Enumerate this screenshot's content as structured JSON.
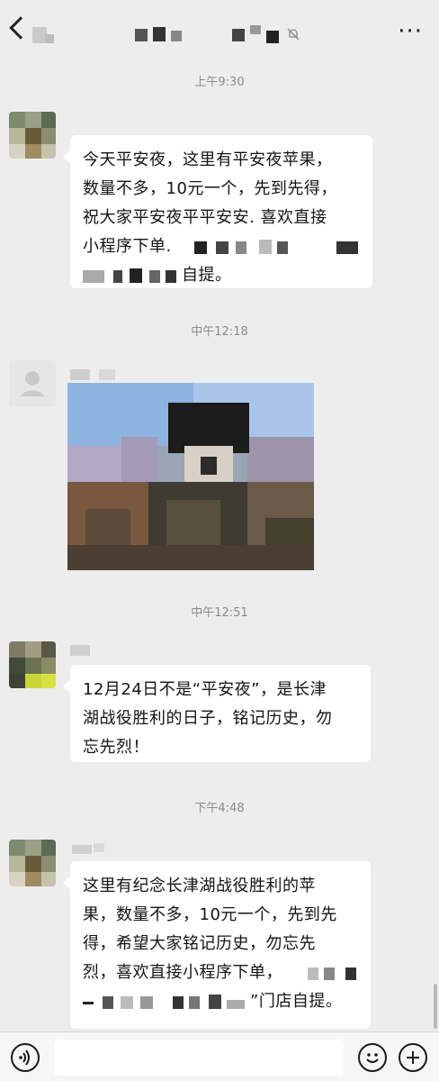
{
  "header": {
    "back_icon": "chevron-left-icon",
    "more_icon": "more-dots-icon",
    "mute_icon": "bell-mute-icon",
    "title_obscured": true
  },
  "messages": [
    {
      "timestamp": "上午9:30",
      "type": "text",
      "lines": [
        "今天平安夜，这里有平安夜苹果，",
        "数量不多，10元一个，先到先得，",
        "祝大家平安夜平平安安. 喜欢直接",
        "小程序下单."
      ],
      "tail": "自提。"
    },
    {
      "timestamp": "中午12:18",
      "type": "image"
    },
    {
      "timestamp": "中午12:51",
      "type": "text",
      "lines": [
        "12月24日不是“平安夜”，是长津",
        "湖战役胜利的日子，铭记历史，勿",
        "忘先烈！"
      ]
    },
    {
      "timestamp": "下午4:48",
      "type": "text",
      "lines": [
        "这里有纪念长津湖战役胜利的苹",
        "果，数量不多，10元一个，先到先",
        "得，希望大家铭记历史，勿忘先",
        "烈，喜欢直接小程序下单，"
      ],
      "tail": "”门店自提。"
    }
  ],
  "input_bar": {
    "voice_icon": "voice-icon",
    "emoji_icon": "emoji-icon",
    "plus_icon": "plus-icon",
    "placeholder": ""
  }
}
